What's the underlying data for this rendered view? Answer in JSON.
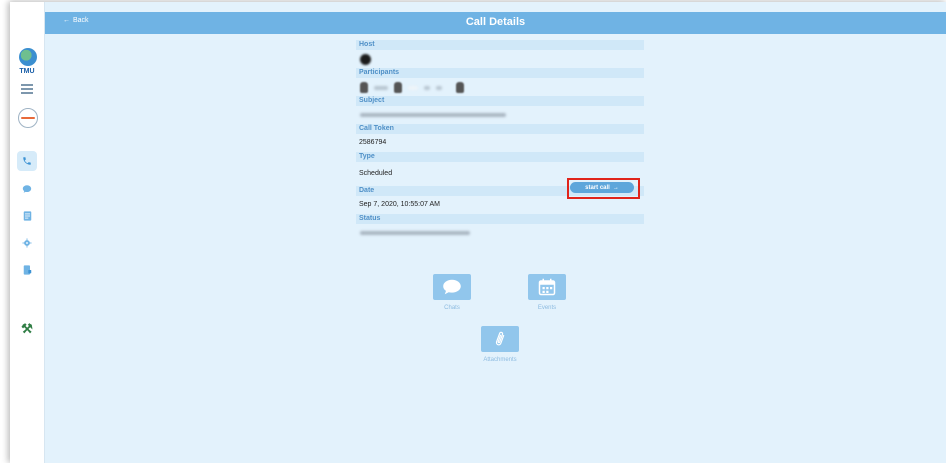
{
  "header": {
    "back_label": "Back",
    "title": "Call Details"
  },
  "sidebar": {
    "logo_text": "TMU",
    "items": [
      {
        "icon": "phone-icon",
        "active": true
      },
      {
        "icon": "chat-icon",
        "active": false
      },
      {
        "icon": "document-icon",
        "active": false
      },
      {
        "icon": "gear-icon",
        "active": false
      },
      {
        "icon": "report-icon",
        "active": false
      }
    ],
    "tool_icon": "tools-icon"
  },
  "details": {
    "host_label": "Host",
    "participants_label": "Participants",
    "subject_label": "Subject",
    "call_token_label": "Call Token",
    "call_token_value": "2586794",
    "type_label": "Type",
    "type_value": "Scheduled",
    "start_call_label": "start call",
    "date_label": "Date",
    "date_value": "Sep 7, 2020, 10:55:07 AM",
    "status_label": "Status"
  },
  "tiles": {
    "chats_label": "Chats",
    "events_label": "Events",
    "attachments_label": "Attachments"
  },
  "colors": {
    "header": "#6fb3e4",
    "background": "#e3f2fc",
    "label_bar": "#d0e8f8",
    "tile": "#91c6ec",
    "highlight": "#e0241b"
  }
}
